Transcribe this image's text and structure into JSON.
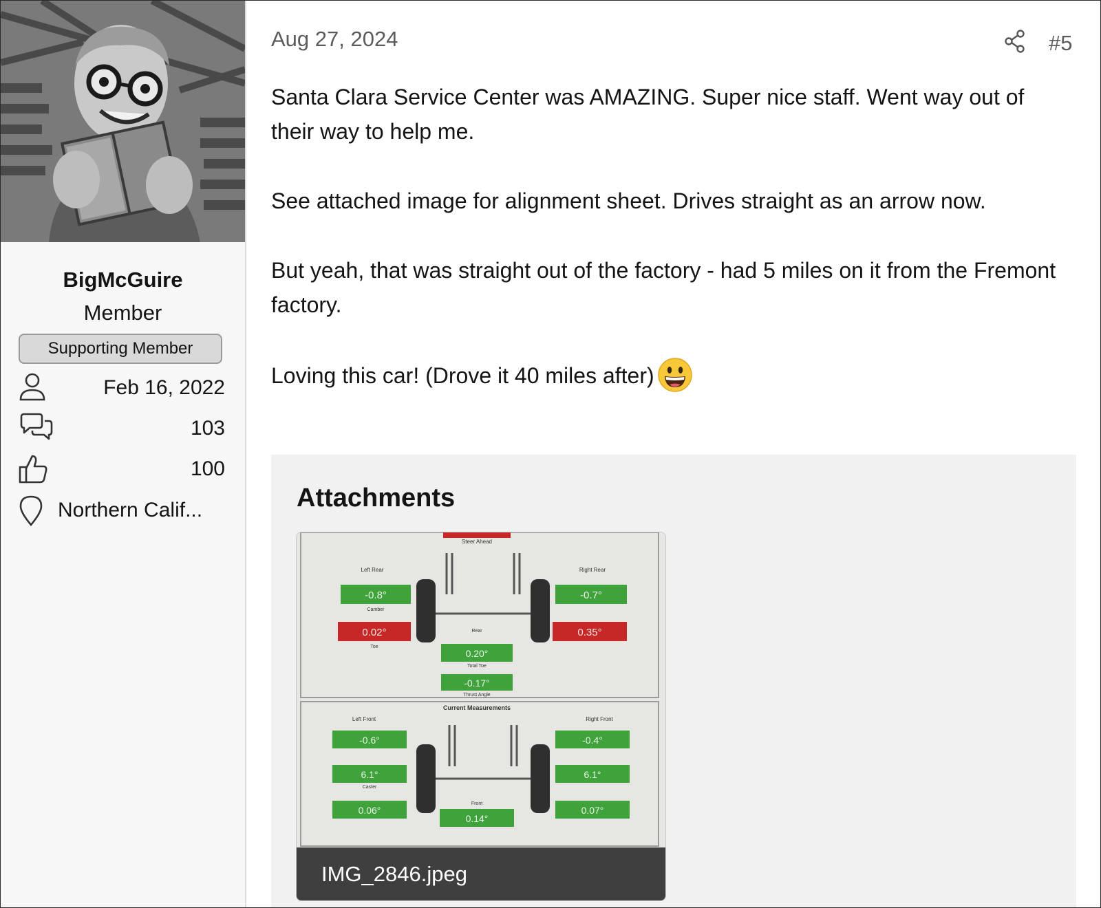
{
  "user": {
    "name": "BigMcGuire",
    "title": "Member",
    "banner": "Supporting Member",
    "joined": "Feb 16, 2022",
    "messages": "103",
    "reactions": "100",
    "location": "Northern Calif..."
  },
  "post": {
    "date": "Aug 27, 2024",
    "number": "#5",
    "paragraphs": [
      "Santa Clara Service Center was AMAZING. Super nice staff. Went way out of their way to help me.",
      "See attached image for alignment sheet. Drives straight as an arrow now.",
      "But yeah, that was straight out of the factory - had 5 miles on it from the Fremont factory.",
      "Loving this car! (Drove it 40 miles after)"
    ]
  },
  "attachments": {
    "heading": "Attachments",
    "items": [
      {
        "filename": "IMG_2846.jpeg",
        "rear_title": "Steer Ahead",
        "front_title": "Current Measurements",
        "left_rear_label": "Left Rear",
        "right_rear_label": "Right Rear",
        "left_front_label": "Left Front",
        "right_front_label": "Right Front",
        "left_rear_camber": "-0.8°",
        "left_rear_toe": "0.02°",
        "right_rear_camber": "-0.7°",
        "right_rear_toe": "0.35°",
        "rear_total_toe": "0.20°",
        "thrust_angle": "-0.17°",
        "left_front_camber": "-0.6°",
        "left_front_caster": "6.1°",
        "left_front_toe": "0.06°",
        "right_front_camber": "-0.4°",
        "right_front_caster": "6.1°",
        "right_front_toe": "0.07°",
        "front_total_toe": "0.14°",
        "camber_label": "Camber",
        "toe_label": "Toe",
        "caster_label": "Caster",
        "rear_label": "Rear",
        "front_label": "Front",
        "total_toe_label": "Total Toe",
        "thrust_label": "Thrust Angle"
      }
    ]
  },
  "colors": {
    "in_spec_green": "#3fa23a",
    "out_of_spec_red": "#c62828",
    "banner_bg": "#d9d9d9",
    "sidebar_bg": "#f7f7f7",
    "attachments_bg": "#f1f1f1"
  },
  "icons": {
    "joined": "user-icon",
    "messages": "chat-bubbles-icon",
    "reactions": "thumbs-up-icon",
    "location": "map-pin-icon",
    "share": "share-icon",
    "emoji": "grinning-face-icon"
  }
}
